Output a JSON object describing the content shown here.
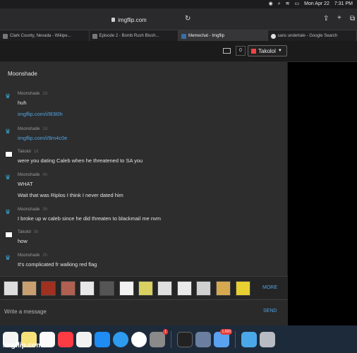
{
  "menubar": {
    "date": "Mon Apr 22",
    "time": "7:31 PM"
  },
  "browser": {
    "url": "imgflip.com",
    "tabs": [
      {
        "title": "Clark County, Nevada - Wikipe..."
      },
      {
        "title": "Episode 2 - Bomb Rush Blush..."
      },
      {
        "title": "Memechat - Imgflip"
      },
      {
        "title": "sans undertale - Google Search"
      }
    ]
  },
  "header": {
    "notif_count": "0",
    "username": "Takolol"
  },
  "chat": {
    "title": "Moonshade",
    "messages": [
      {
        "name": "Moonshade",
        "time": "2d",
        "lines": [
          "huh",
          "imgflip.com/i/8l3l0h"
        ]
      },
      {
        "name": "Moonshade",
        "time": "2d",
        "lines": [
          "imgflip.com/i/8m4c0e"
        ]
      },
      {
        "name": "Takolol",
        "time": "1d",
        "lines": [
          "were you dating Caleb when he threatened to SA you"
        ]
      },
      {
        "name": "Moonshade",
        "time": "4h",
        "lines": [
          "WHAT",
          "Wait that was Riplos I think I never dated him"
        ]
      },
      {
        "name": "Moonshade",
        "time": "3h",
        "lines": [
          "I broke up w caleb since he did threaten to blackmail me nvm"
        ]
      },
      {
        "name": "Takolol",
        "time": "3h",
        "lines": [
          "how"
        ]
      },
      {
        "name": "Moonshade",
        "time": "2h",
        "lines": [
          "It's complicated fr walking red flag"
        ]
      }
    ]
  },
  "memebar": {
    "more_label": "MORE"
  },
  "composer": {
    "placeholder": "Write a message",
    "send_label": "SEND"
  },
  "dock": {
    "app_store_badge": "1",
    "mail_badge": "1,693"
  },
  "watermark": "imgflip.com"
}
